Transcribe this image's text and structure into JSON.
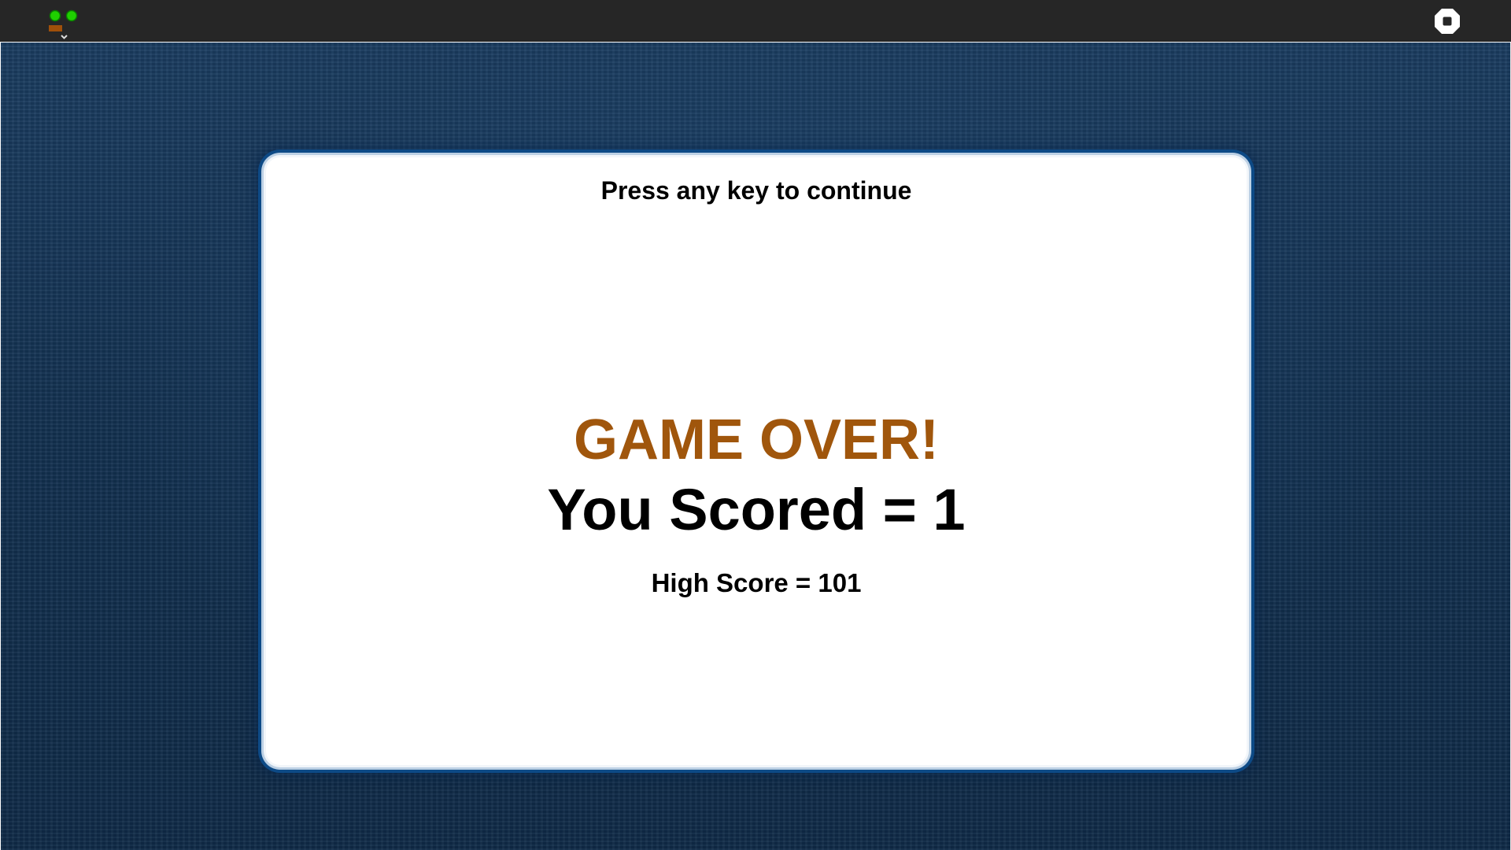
{
  "toolbar": {
    "green_flag_icon": "green-flag-icon",
    "stop_icon": "stop-icon"
  },
  "game": {
    "continue_prompt": "Press any key to continue",
    "game_over": "GAME OVER!",
    "score_text": "You Scored = 1",
    "high_score_text": "High Score = 101",
    "score": 1,
    "high_score": 101
  },
  "colors": {
    "top_bar": "#262626",
    "stage_background": "#163a5f",
    "card_border": "#0d4a86",
    "game_over_text": "#a0560c",
    "green_flag": "#1fd000",
    "flag_brown": "#a0500a"
  }
}
